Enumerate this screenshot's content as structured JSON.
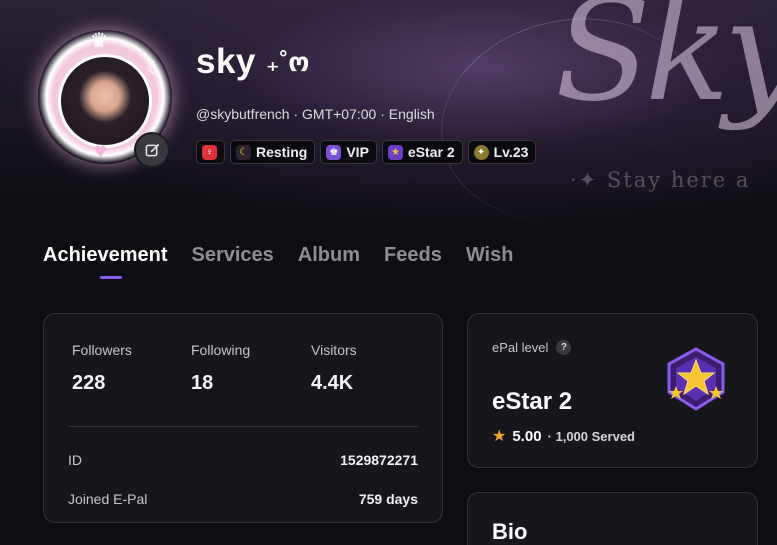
{
  "banner": {
    "script_text": "Sky",
    "tagline": "·✦ Stay here a"
  },
  "profile": {
    "display_name": "sky",
    "name_decoration": "₊˚ო",
    "meta": "@skybutfrench · GMT+07:00 · English",
    "badges": [
      {
        "icon": "gender-female-icon",
        "label": "",
        "color": "#e0323c"
      },
      {
        "icon": "moon-icon",
        "label": "Resting",
        "color": "#2a2630"
      },
      {
        "icon": "vip-icon",
        "label": "VIP",
        "color": "#7b4fd6"
      },
      {
        "icon": "estar-icon",
        "label": "eStar 2",
        "color": "#6c3fc9"
      },
      {
        "icon": "level-icon",
        "label": "Lv.23",
        "color": "#8a7a2e"
      }
    ]
  },
  "tabs": [
    {
      "label": "Achievement",
      "active": true
    },
    {
      "label": "Services",
      "active": false
    },
    {
      "label": "Album",
      "active": false
    },
    {
      "label": "Feeds",
      "active": false
    },
    {
      "label": "Wish",
      "active": false
    }
  ],
  "stats": {
    "followers_label": "Followers",
    "followers_value": "228",
    "following_label": "Following",
    "following_value": "18",
    "visitors_label": "Visitors",
    "visitors_value": "4.4K",
    "id_label": "ID",
    "id_value": "1529872271",
    "joined_label": "Joined E-Pal",
    "joined_value": "759 days"
  },
  "level": {
    "label": "ePal level",
    "help": "?",
    "name": "eStar 2",
    "rating": "5.00",
    "served": "· 1,000 Served"
  },
  "bio": {
    "title": "Bio"
  },
  "colors": {
    "accent": "#8a5cf6",
    "star": "#f5a623"
  }
}
